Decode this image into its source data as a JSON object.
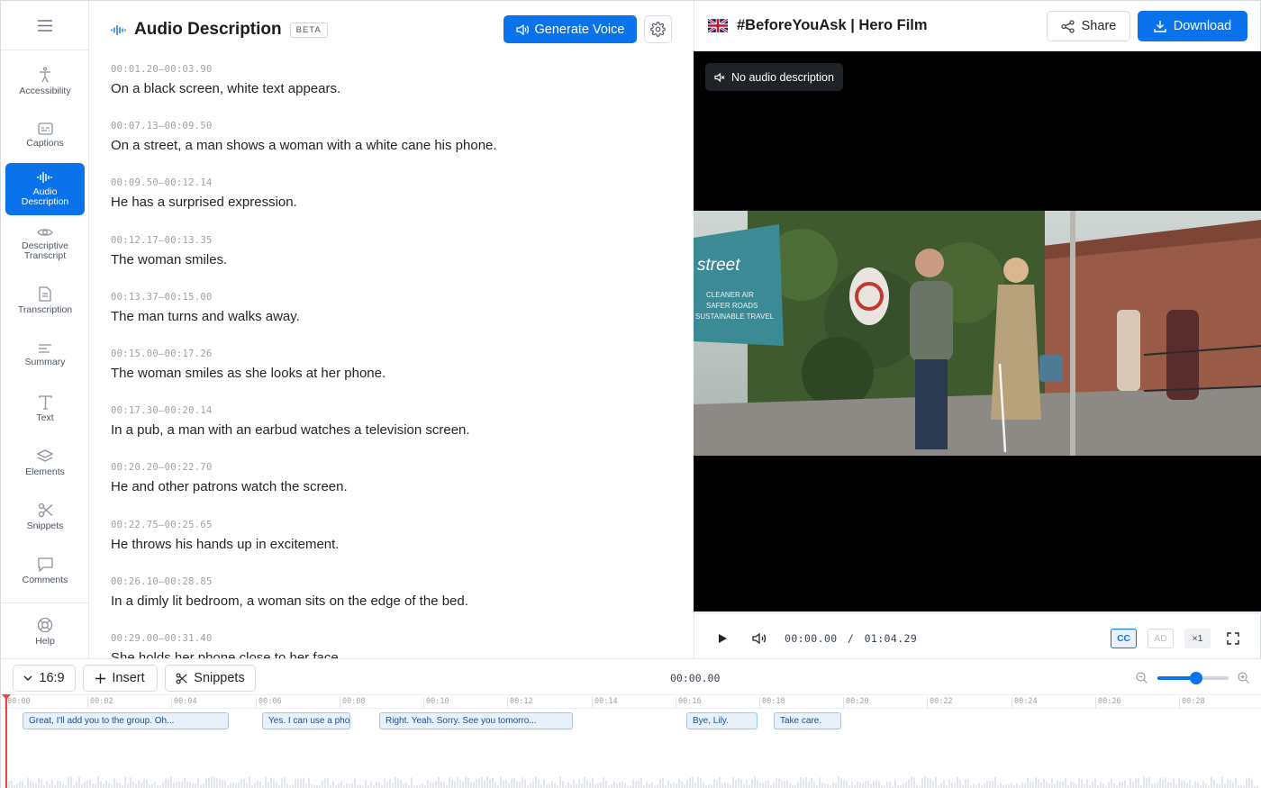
{
  "sidebar": {
    "items": [
      {
        "label": "Accessibility",
        "icon": "accessibility-icon"
      },
      {
        "label": "Captions",
        "icon": "captions-icon"
      },
      {
        "label": "Audio\nDescription",
        "icon": "audio-waveform-icon",
        "active": true
      },
      {
        "label": "Descriptive\nTranscript",
        "icon": "eye-icon"
      },
      {
        "label": "Transcription",
        "icon": "document-icon"
      },
      {
        "label": "Summary",
        "icon": "summary-lines-icon"
      },
      {
        "label": "Text",
        "icon": "text-icon"
      },
      {
        "label": "Elements",
        "icon": "layers-icon"
      },
      {
        "label": "Snippets",
        "icon": "scissors-icon"
      },
      {
        "label": "Comments",
        "icon": "comment-icon"
      },
      {
        "label": "Help",
        "icon": "lifebuoy-icon"
      }
    ]
  },
  "description_panel": {
    "title": "Audio Description",
    "badge": "BETA",
    "generate_label": "Generate Voice",
    "entries": [
      {
        "time": "00:01.20–00:03.90",
        "text": "On a black screen, white text appears."
      },
      {
        "time": "00:07.13–00:09.50",
        "text": "On a street, a man shows a woman with a white cane his phone."
      },
      {
        "time": "00:09.50–00:12.14",
        "text": "He has a surprised expression."
      },
      {
        "time": "00:12.17–00:13.35",
        "text": "The woman smiles."
      },
      {
        "time": "00:13.37–00:15.00",
        "text": "The man turns and walks away."
      },
      {
        "time": "00:15.00–00:17.26",
        "text": "The woman smiles as she looks at her phone."
      },
      {
        "time": "00:17.30–00:20.14",
        "text": "In a pub, a man with an earbud watches a television screen."
      },
      {
        "time": "00:20.20–00:22.70",
        "text": "He and other patrons watch the screen."
      },
      {
        "time": "00:22.75–00:25.65",
        "text": "He throws his hands up in excitement."
      },
      {
        "time": "00:26.10–00:28.85",
        "text": "In a dimly lit bedroom, a woman sits on the edge of the bed."
      },
      {
        "time": "00:29.00–00:31.40",
        "text": "She holds her phone close to her face."
      }
    ]
  },
  "video_header": {
    "title": "#BeforeYouAsk | Hero Film",
    "share_label": "Share",
    "download_label": "Download"
  },
  "video": {
    "overlay_label": "No audio description",
    "scene_signs": [
      "street",
      "CLEANER AIR",
      "SAFER ROADS",
      "SUSTAINABLE TRAVEL"
    ]
  },
  "player": {
    "current": "00:00.00",
    "separator": "/",
    "duration": "01:04.29",
    "cc_label": "CC",
    "ad_label": "AD",
    "speed_label": "×1"
  },
  "timeline": {
    "aspect_label": "16:9",
    "insert_label": "Insert",
    "snippets_label": "Snippets",
    "current_time": "00:00.00",
    "zoom_level": 0.55,
    "ticks": [
      "00:00",
      "00:02",
      "00:04",
      "00:06",
      "00:08",
      "00:10",
      "00:12",
      "00:14",
      "00:16",
      "00:18",
      "00:20",
      "00:22",
      "00:24",
      "00:26",
      "00:28"
    ],
    "clips": [
      {
        "text": "Great, I'll add you to the group. Oh..."
      },
      {
        "text": "Yes. I can use a phone."
      },
      {
        "text": "Right. Yeah. Sorry. See you tomorro..."
      },
      {
        "text": "Bye, Lily."
      },
      {
        "text": "Take care."
      }
    ]
  },
  "colors": {
    "accent": "#0a73eb",
    "playhead": "#ef4444"
  }
}
